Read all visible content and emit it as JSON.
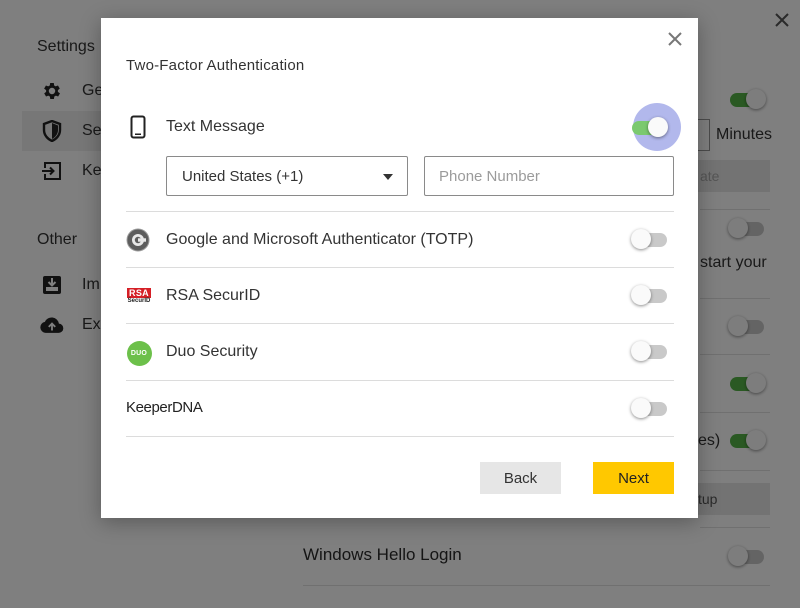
{
  "background": {
    "sidebar": {
      "heading": "Settings",
      "items": [
        {
          "label": "Ge",
          "icon": "gear-icon"
        },
        {
          "label": "Se",
          "icon": "shield-icon"
        },
        {
          "label": "Ke",
          "icon": "login-icon"
        }
      ],
      "other_heading": "Other",
      "other_items": [
        {
          "label": "Im",
          "icon": "import-icon"
        },
        {
          "label": "Ex",
          "icon": "cloud-upload-icon"
        }
      ]
    },
    "right_fragments": {
      "minutes": "Minutes",
      "update": "ate",
      "restart": "start your",
      "minutes_paren": "es)",
      "setup": "tup"
    },
    "bottom_row": {
      "label": "Windows Hello Login"
    }
  },
  "modal": {
    "title": "Two-Factor Authentication",
    "methods": [
      {
        "label": "Text Message",
        "icon": "mobile-phone-icon",
        "enabled": true
      },
      {
        "label": "Google and Microsoft Authenticator (TOTP)",
        "icon": "google-authenticator-icon",
        "enabled": false
      },
      {
        "label": "RSA SecurID",
        "icon": "rsa-securid-logo-icon",
        "enabled": false
      },
      {
        "label": "Duo Security",
        "icon": "duo-logo-icon",
        "enabled": false
      },
      {
        "label": "KeeperDNA",
        "icon": "keeperdna-logo-icon",
        "enabled": false
      }
    ],
    "country_select": {
      "value": "United States (+1)"
    },
    "phone_input": {
      "placeholder": "Phone Number",
      "value": ""
    },
    "buttons": {
      "back": "Back",
      "next": "Next"
    },
    "logos": {
      "rsa_top": "RSA",
      "rsa_bottom": "SecurID",
      "duo": "DUO",
      "keeper_dna": "KeeperDNA"
    }
  },
  "colors": {
    "toggle_on": "#55b347",
    "next_button": "#ffc800",
    "focus_halo": "#737ddc",
    "overlay": "rgba(0,0,0,0.5)"
  }
}
